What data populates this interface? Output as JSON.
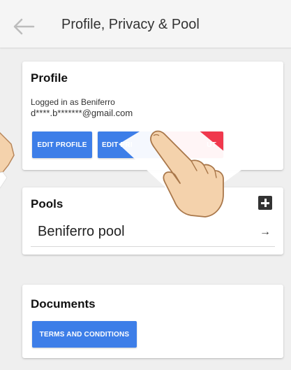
{
  "header": {
    "title": "Profile, Privacy & Pool",
    "back_icon": "arrow-left-icon"
  },
  "profile": {
    "title": "Profile",
    "logged_in": "Logged in as  Beniferro",
    "email": "d****.b*******@gmail.com",
    "buttons": {
      "edit_profile": "EDIT PROFILE",
      "edit_privacy": "EDIT PRI",
      "logout": "UT"
    }
  },
  "pools": {
    "title": "Pools",
    "add_icon": "plus-square-icon",
    "items": [
      {
        "name": "Beniferro pool",
        "arrow": "→"
      }
    ]
  },
  "documents": {
    "title": "Documents",
    "terms_button": "TERMS AND CONDITIONS"
  },
  "colors": {
    "primary_button": "#3d7ee8",
    "danger_button": "#f0384d",
    "card_background": "#ffffff",
    "page_background": "#efefef"
  }
}
